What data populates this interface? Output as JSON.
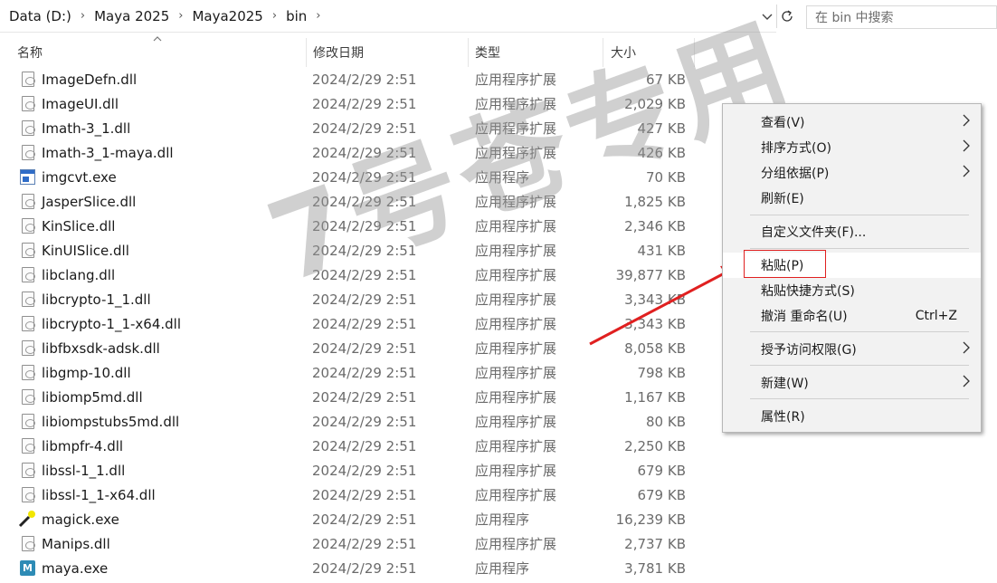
{
  "address": {
    "crumbs": [
      "Data (D:)",
      "Maya 2025",
      "Maya2025",
      "bin"
    ],
    "separator": "›",
    "dropdown_icon": "chevron-down-icon",
    "refresh_icon": "refresh-icon"
  },
  "search": {
    "placeholder": "在 bin 中搜索"
  },
  "columns": {
    "name": "名称",
    "date": "修改日期",
    "type": "类型",
    "size": "大小"
  },
  "files": [
    {
      "name": "ImageDefn.dll",
      "date": "2024/2/29 2:51",
      "type": "应用程序扩展",
      "size": "67 KB",
      "icon": "dll-icon"
    },
    {
      "name": "ImageUI.dll",
      "date": "2024/2/29 2:51",
      "type": "应用程序扩展",
      "size": "2,029 KB",
      "icon": "dll-icon"
    },
    {
      "name": "Imath-3_1.dll",
      "date": "2024/2/29 2:51",
      "type": "应用程序扩展",
      "size": "427 KB",
      "icon": "dll-icon"
    },
    {
      "name": "Imath-3_1-maya.dll",
      "date": "2024/2/29 2:51",
      "type": "应用程序扩展",
      "size": "426 KB",
      "icon": "dll-icon"
    },
    {
      "name": "imgcvt.exe",
      "date": "2024/2/29 2:51",
      "type": "应用程序",
      "size": "70 KB",
      "icon": "exe-icon"
    },
    {
      "name": "JasperSlice.dll",
      "date": "2024/2/29 2:51",
      "type": "应用程序扩展",
      "size": "1,825 KB",
      "icon": "dll-icon"
    },
    {
      "name": "KinSlice.dll",
      "date": "2024/2/29 2:51",
      "type": "应用程序扩展",
      "size": "2,346 KB",
      "icon": "dll-icon"
    },
    {
      "name": "KinUISlice.dll",
      "date": "2024/2/29 2:51",
      "type": "应用程序扩展",
      "size": "431 KB",
      "icon": "dll-icon"
    },
    {
      "name": "libclang.dll",
      "date": "2024/2/29 2:51",
      "type": "应用程序扩展",
      "size": "39,877 KB",
      "icon": "dll-icon"
    },
    {
      "name": "libcrypto-1_1.dll",
      "date": "2024/2/29 2:51",
      "type": "应用程序扩展",
      "size": "3,343 KB",
      "icon": "dll-icon"
    },
    {
      "name": "libcrypto-1_1-x64.dll",
      "date": "2024/2/29 2:51",
      "type": "应用程序扩展",
      "size": "3,343 KB",
      "icon": "dll-icon"
    },
    {
      "name": "libfbxsdk-adsk.dll",
      "date": "2024/2/29 2:51",
      "type": "应用程序扩展",
      "size": "8,058 KB",
      "icon": "dll-icon"
    },
    {
      "name": "libgmp-10.dll",
      "date": "2024/2/29 2:51",
      "type": "应用程序扩展",
      "size": "798 KB",
      "icon": "dll-icon"
    },
    {
      "name": "libiomp5md.dll",
      "date": "2024/2/29 2:51",
      "type": "应用程序扩展",
      "size": "1,167 KB",
      "icon": "dll-icon"
    },
    {
      "name": "libiompstubs5md.dll",
      "date": "2024/2/29 2:51",
      "type": "应用程序扩展",
      "size": "80 KB",
      "icon": "dll-icon"
    },
    {
      "name": "libmpfr-4.dll",
      "date": "2024/2/29 2:51",
      "type": "应用程序扩展",
      "size": "2,250 KB",
      "icon": "dll-icon"
    },
    {
      "name": "libssl-1_1.dll",
      "date": "2024/2/29 2:51",
      "type": "应用程序扩展",
      "size": "679 KB",
      "icon": "dll-icon"
    },
    {
      "name": "libssl-1_1-x64.dll",
      "date": "2024/2/29 2:51",
      "type": "应用程序扩展",
      "size": "679 KB",
      "icon": "dll-icon"
    },
    {
      "name": "magick.exe",
      "date": "2024/2/29 2:51",
      "type": "应用程序",
      "size": "16,239 KB",
      "icon": "magic-wand-icon"
    },
    {
      "name": "Manips.dll",
      "date": "2024/2/29 2:51",
      "type": "应用程序扩展",
      "size": "2,737 KB",
      "icon": "dll-icon"
    },
    {
      "name": "maya.exe",
      "date": "2024/2/29 2:51",
      "type": "应用程序",
      "size": "3,781 KB",
      "icon": "maya-icon"
    }
  ],
  "context_menu": {
    "items": [
      {
        "label": "查看(V)",
        "submenu": true
      },
      {
        "label": "排序方式(O)",
        "submenu": true
      },
      {
        "label": "分组依据(P)",
        "submenu": true
      },
      {
        "label": "刷新(E)",
        "submenu": false
      },
      {
        "label": "自定义文件夹(F)...",
        "submenu": false
      },
      {
        "label": "粘贴(P)",
        "submenu": false,
        "highlighted": true
      },
      {
        "label": "粘贴快捷方式(S)",
        "submenu": false
      },
      {
        "label": "撤消 重命名(U)",
        "submenu": false,
        "accelerator": "Ctrl+Z"
      },
      {
        "label": "授予访问权限(G)",
        "submenu": true
      },
      {
        "label": "新建(W)",
        "submenu": true
      },
      {
        "label": "属性(R)",
        "submenu": false
      }
    ]
  },
  "watermark": {
    "text": "7号苍专用"
  },
  "colors": {
    "accent_red": "#e02020",
    "watermark_gray": "#969696"
  }
}
